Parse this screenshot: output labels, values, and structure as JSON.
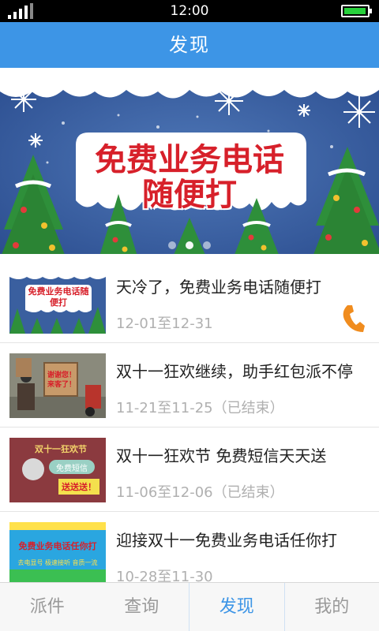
{
  "status_bar": {
    "time": "12:00",
    "battery_level": 0.95
  },
  "header": {
    "title": "发现"
  },
  "banner": {
    "headline_line1": "免费业务电话",
    "headline_line2": "随便打",
    "slide_count": 3,
    "active_slide": 1
  },
  "items": [
    {
      "title": "天冷了，免费业务电话随便打",
      "date": "12-01至12-31",
      "thumb_text": "免费业务电话随便打",
      "has_call_icon": true
    },
    {
      "title": "双十一狂欢继续，助手红包派不停",
      "date": "11-21至11-25（已结束）",
      "thumb_text": "谢谢您！来客了！"
    },
    {
      "title": "双十一狂欢节 免费短信天天送",
      "date": "11-06至12-06（已结束）",
      "thumb_text_1": "双十一狂欢节",
      "thumb_text_2": "免费短信",
      "thumb_text_3": "送送送！"
    },
    {
      "title": "迎接双十一免费业务电话任你打",
      "date": "10-28至11-30",
      "thumb_text_1": "免费业务电话任你打",
      "thumb_text_2": "去电显号 极速接听 音质一流"
    }
  ],
  "tabs": [
    {
      "label": "派件",
      "active": false
    },
    {
      "label": "查询",
      "active": false
    },
    {
      "label": "发现",
      "active": true
    },
    {
      "label": "我的",
      "active": false
    }
  ],
  "colors": {
    "primary": "#3d95e6",
    "accent_orange": "#f08c1e",
    "banner_red": "#d7202a"
  }
}
